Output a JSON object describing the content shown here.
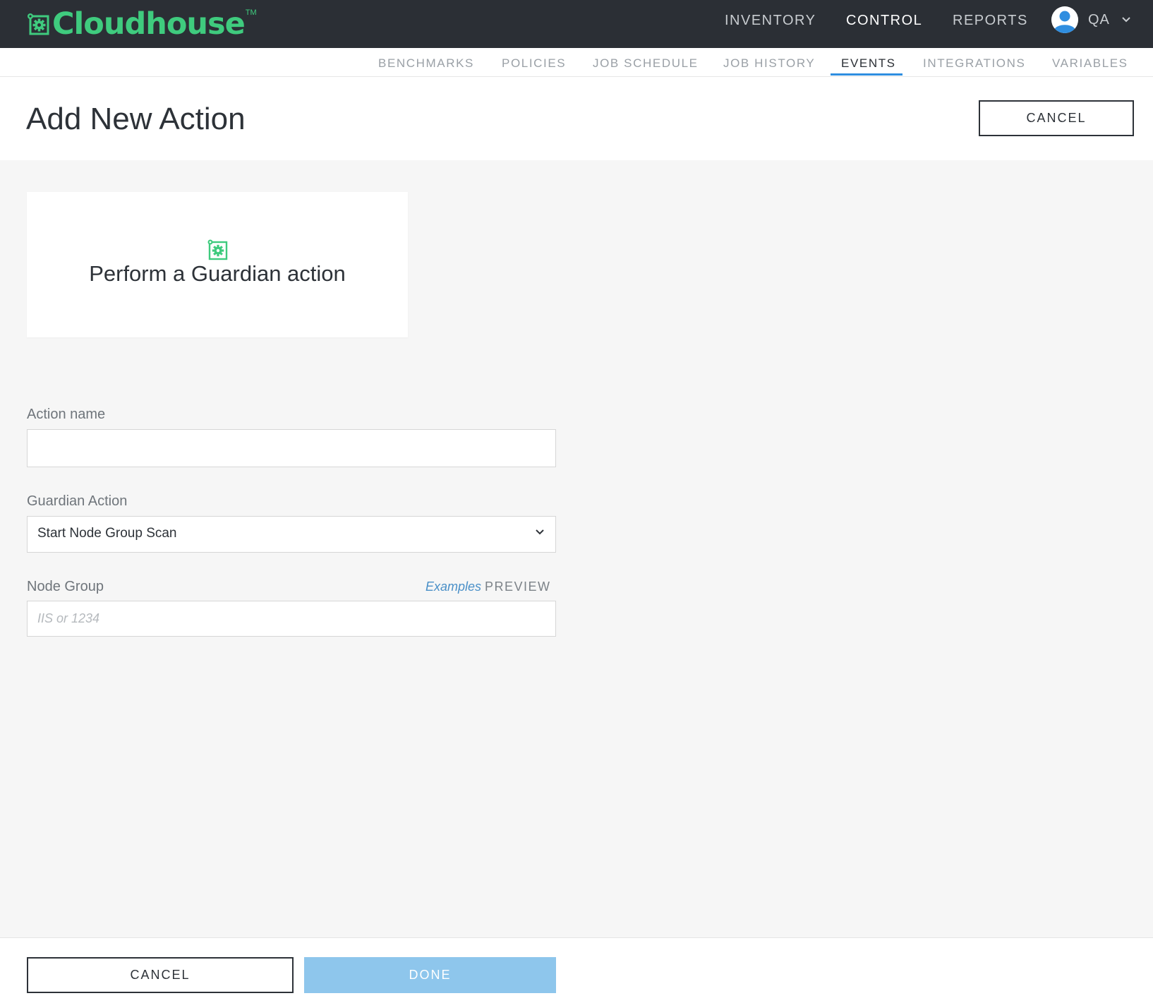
{
  "app": {
    "brand": "Cloudhouse",
    "trademark": "TM"
  },
  "topnav": {
    "items": [
      {
        "label": "INVENTORY",
        "active": false
      },
      {
        "label": "CONTROL",
        "active": true
      },
      {
        "label": "REPORTS",
        "active": false
      }
    ],
    "user_label": "QA"
  },
  "subnav": {
    "items": [
      {
        "label": "BENCHMARKS",
        "active": false
      },
      {
        "label": "POLICIES",
        "active": false
      },
      {
        "label": "JOB SCHEDULE",
        "active": false
      },
      {
        "label": "JOB HISTORY",
        "active": false
      },
      {
        "label": "EVENTS",
        "active": true
      },
      {
        "label": "INTEGRATIONS",
        "active": false
      },
      {
        "label": "VARIABLES",
        "active": false
      }
    ]
  },
  "header": {
    "title": "Add New Action",
    "cancel_label": "CANCEL"
  },
  "card": {
    "icon": "gear-icon",
    "title": "Perform a Guardian action"
  },
  "form": {
    "action_name": {
      "label": "Action name",
      "value": "",
      "placeholder": ""
    },
    "guardian_action": {
      "label": "Guardian Action",
      "selected": "Start Node Group Scan"
    },
    "node_group": {
      "label": "Node Group",
      "examples_label": "Examples",
      "preview_label": "PREVIEW",
      "value": "",
      "placeholder": "IIS or 1234"
    }
  },
  "footer": {
    "cancel_label": "CANCEL",
    "done_label": "DONE",
    "done_enabled": false
  },
  "colors": {
    "topbar_bg": "#2b2f35",
    "brand_green": "#3fcb7e",
    "accent_blue": "#2f8ee0",
    "done_disabled": "#8ec6ec",
    "page_bg": "#f6f6f6"
  }
}
